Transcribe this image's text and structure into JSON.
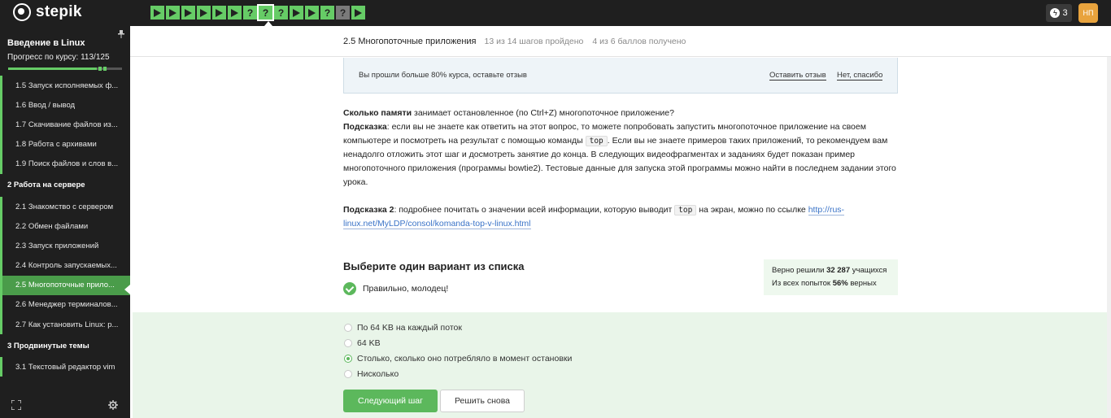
{
  "brand": {
    "name": "stepik"
  },
  "steps": [
    {
      "type": "play",
      "state": "green"
    },
    {
      "type": "play",
      "state": "green"
    },
    {
      "type": "play",
      "state": "green"
    },
    {
      "type": "play",
      "state": "green"
    },
    {
      "type": "play",
      "state": "green"
    },
    {
      "type": "play",
      "state": "green"
    },
    {
      "type": "quiz",
      "state": "green",
      "label": "?"
    },
    {
      "type": "quiz",
      "state": "green",
      "label": "?",
      "current": true
    },
    {
      "type": "quiz",
      "state": "green",
      "label": "?"
    },
    {
      "type": "play",
      "state": "green"
    },
    {
      "type": "play",
      "state": "green"
    },
    {
      "type": "quiz",
      "state": "green",
      "label": "?"
    },
    {
      "type": "quiz",
      "state": "gray",
      "label": "?"
    },
    {
      "type": "play",
      "state": "green"
    }
  ],
  "header": {
    "energy_count": "3",
    "avatar_initials": "НП"
  },
  "sidebar": {
    "course_title": "Введение в Linux",
    "progress_label": "Прогресс по курсу:  113/125",
    "progress": {
      "done": 113,
      "total": 125
    },
    "items": [
      {
        "label": "1.5  Запуск исполняемых ф...",
        "kind": "lesson"
      },
      {
        "label": "1.6  Ввод / вывод",
        "kind": "lesson"
      },
      {
        "label": "1.7  Скачивание файлов из...",
        "kind": "lesson"
      },
      {
        "label": "1.8  Работа с архивами",
        "kind": "lesson"
      },
      {
        "label": "1.9  Поиск файлов и слов в...",
        "kind": "lesson"
      },
      {
        "label": "2  Работа на сервере",
        "kind": "section"
      },
      {
        "label": "2.1  Знакомство с сервером",
        "kind": "lesson"
      },
      {
        "label": "2.2  Обмен файлами",
        "kind": "lesson"
      },
      {
        "label": "2.3  Запуск приложений",
        "kind": "lesson"
      },
      {
        "label": "2.4  Контроль запускаемых...",
        "kind": "lesson"
      },
      {
        "label": "2.5  Многопоточные прило...",
        "kind": "lesson",
        "active": true
      },
      {
        "label": "2.6  Менеджер терминалов...",
        "kind": "lesson"
      },
      {
        "label": "2.7  Как установить Linux: р...",
        "kind": "lesson"
      },
      {
        "label": "3  Продвинутые темы",
        "kind": "section"
      },
      {
        "label": "3.1  Текстовый редактор vim",
        "kind": "lesson"
      }
    ]
  },
  "lesson": {
    "title": "2.5 Многопоточные приложения",
    "steps_done": "13 из 14 шагов пройдено",
    "score": "4 из 6 баллов  получено"
  },
  "feedback": {
    "text": "Вы прошли больше 80% курса, оставьте отзыв",
    "leave_review": "Оставить отзыв",
    "no_thanks": "Нет, спасибо"
  },
  "question": {
    "q_bold": "Сколько памяти",
    "q_rest": " занимает остановленное (по Ctrl+Z) многопоточное приложение?",
    "hint1_label": "Подсказка",
    "hint1_a": ": если вы не знаете как ответить на этот вопрос, то можете попробовать запустить многопоточное приложение на своем компьютере и посмотреть на результат с помощью команды ",
    "code_top": "top",
    "hint1_b": ". Если вы не знаете примеров таких приложений, то рекомендуем вам ненадолго отложить этот шаг и досмотреть занятие до конца. В следующих видеофрагментах и заданиях будет показан пример многопоточного приложения (программы bowtie2). Тестовые данные для запуска этой программы можно найти в последнем задании этого урока.",
    "hint2_label": "Подсказка 2",
    "hint2_a": ": подробнее почитать о значении всей информации, которую выводит ",
    "hint2_b": " на экран, можно по ссылке ",
    "link": "http://rus-linux.net/MyLDP/consol/komanda-top-v-linux.html"
  },
  "quiz": {
    "title": "Выберите один вариант из списка",
    "result": "Правильно, молодец!",
    "stats_line1_a": "Верно решили ",
    "stats_solved": "32 287",
    "stats_line1_b": " учащихся",
    "stats_line2_a": "Из всех попыток ",
    "stats_percent": "56%",
    "stats_line2_b": " верных",
    "options": [
      {
        "label": "По 64 KB на каждый поток",
        "selected": false
      },
      {
        "label": "64 KB",
        "selected": false
      },
      {
        "label": "Столько, сколько оно потребляло в момент остановки",
        "selected": true
      },
      {
        "label": "Нисколько",
        "selected": false
      }
    ],
    "next_button": "Следующий шаг",
    "retry_button": "Решить снова"
  },
  "colors": {
    "accent_green": "#5cb85c",
    "step_green": "#66cc66",
    "dark_bg": "#1f1f1f",
    "avatar": "#e8a33d"
  }
}
